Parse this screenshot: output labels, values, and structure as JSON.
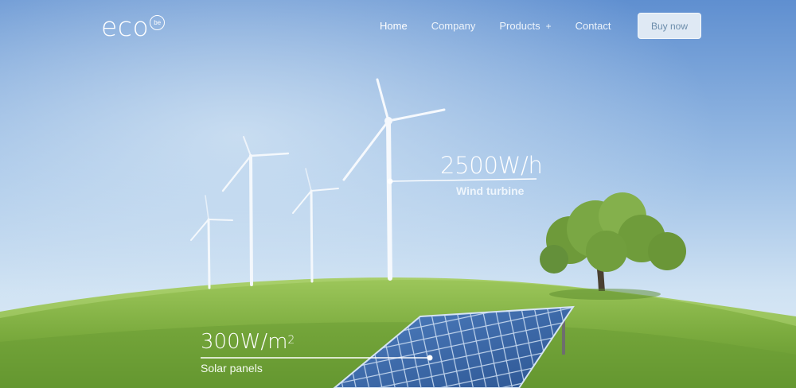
{
  "brand": {
    "name": "eco",
    "badge": "be"
  },
  "nav": {
    "items": [
      {
        "label": "Home",
        "active": true
      },
      {
        "label": "Company"
      },
      {
        "label": "Products",
        "suffix": "+"
      },
      {
        "label": "Contact"
      }
    ]
  },
  "cta": {
    "label": "Buy now"
  },
  "callouts": {
    "wind": {
      "value": "2500W/h",
      "label": "Wind turbine"
    },
    "solar": {
      "value": "300W/m",
      "superscript": "2",
      "label": "Solar panels"
    }
  },
  "colors": {
    "sky_top": "#5f8fd0",
    "sky_bottom": "#cfe2f3",
    "grass": "#7bab3e",
    "panel": "#3c6aa8"
  }
}
